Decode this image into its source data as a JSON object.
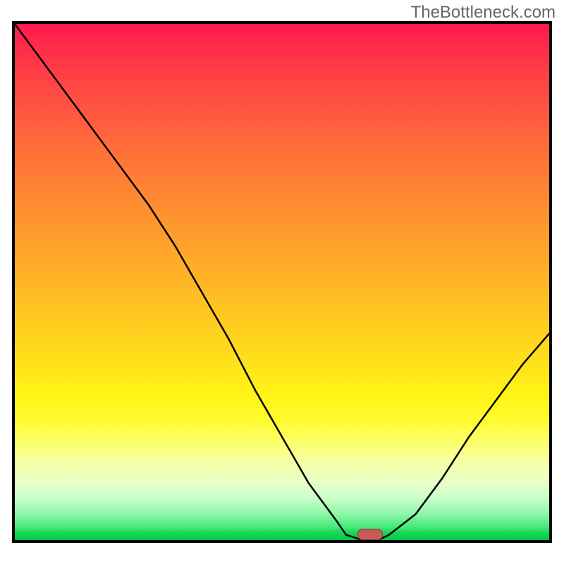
{
  "watermark": "TheBottleneck.com",
  "colors": {
    "frame_border": "#000000",
    "curve_stroke": "#000000",
    "marker_fill": "#c85a5a",
    "marker_border": "#8a3a3a",
    "gradient_top": "#ff1a4d",
    "gradient_bottom": "#00c84c"
  },
  "chart_data": {
    "type": "line",
    "title": "",
    "xlabel": "",
    "ylabel": "",
    "xlim": [
      0,
      1
    ],
    "ylim": [
      0,
      1
    ],
    "x": [
      0.0,
      0.05,
      0.1,
      0.15,
      0.2,
      0.25,
      0.3,
      0.35,
      0.4,
      0.45,
      0.5,
      0.55,
      0.6,
      0.62,
      0.65,
      0.68,
      0.7,
      0.75,
      0.8,
      0.85,
      0.9,
      0.95,
      1.0
    ],
    "y": [
      1.0,
      0.93,
      0.86,
      0.79,
      0.72,
      0.65,
      0.57,
      0.48,
      0.39,
      0.29,
      0.2,
      0.11,
      0.04,
      0.01,
      0.0,
      0.0,
      0.01,
      0.05,
      0.12,
      0.2,
      0.27,
      0.34,
      0.4
    ],
    "marker": {
      "x": 0.665,
      "y": 0.0
    },
    "note": "ticks and axis labels are not shown; values are normalized 0..1 fractions of plot area"
  }
}
